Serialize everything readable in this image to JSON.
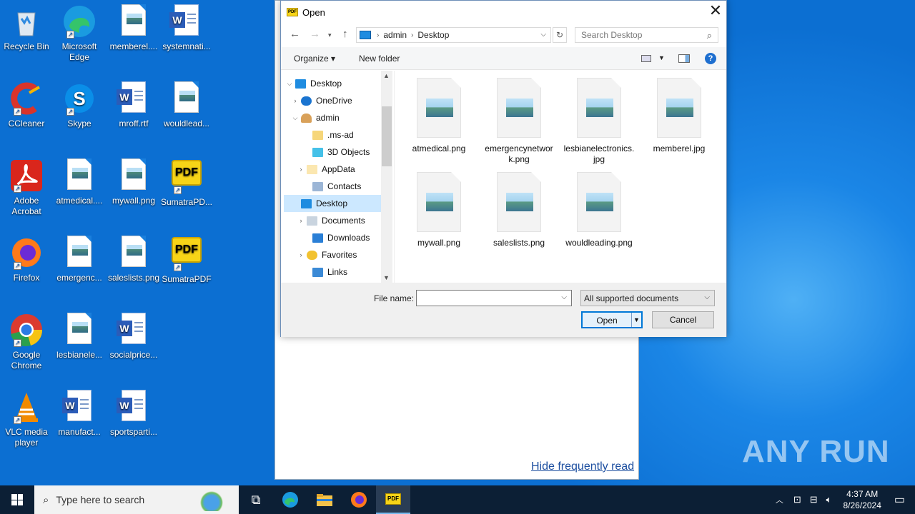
{
  "desktop": {
    "icons": [
      {
        "label": "Recycle Bin"
      },
      {
        "label": "Microsoft Edge"
      },
      {
        "label": "memberel...."
      },
      {
        "label": "systemnati..."
      },
      {
        "label": "CCleaner"
      },
      {
        "label": "Skype"
      },
      {
        "label": "mroff.rtf"
      },
      {
        "label": "wouldlead..."
      },
      {
        "label": "Adobe Acrobat"
      },
      {
        "label": "atmedical...."
      },
      {
        "label": "mywall.png"
      },
      {
        "label": "SumatraPD..."
      },
      {
        "label": "Firefox"
      },
      {
        "label": "emergenc..."
      },
      {
        "label": "saleslists.png"
      },
      {
        "label": "SumatraPDF"
      },
      {
        "label": "Google Chrome"
      },
      {
        "label": "lesbianele..."
      },
      {
        "label": "socialprice..."
      },
      {
        "label": "VLC media player"
      },
      {
        "label": "manufact..."
      },
      {
        "label": "sportsparti..."
      }
    ]
  },
  "background_window": {
    "hide_link": "Hide frequently read"
  },
  "watermark": "ANY RUN",
  "dialog": {
    "title": "Open",
    "address": {
      "crumbs": [
        "admin",
        "Desktop"
      ]
    },
    "search_placeholder": "Search Desktop",
    "toolbar": {
      "organize": "Organize ▾",
      "new_folder": "New folder"
    },
    "tree": [
      {
        "label": "Desktop"
      },
      {
        "label": "OneDrive"
      },
      {
        "label": "admin"
      },
      {
        "label": ".ms-ad"
      },
      {
        "label": "3D Objects"
      },
      {
        "label": "AppData"
      },
      {
        "label": "Contacts"
      },
      {
        "label": "Desktop"
      },
      {
        "label": "Documents"
      },
      {
        "label": "Downloads"
      },
      {
        "label": "Favorites"
      },
      {
        "label": "Links"
      }
    ],
    "files": [
      {
        "name": "atmedical.png"
      },
      {
        "name": "emergencynetwork.png"
      },
      {
        "name": "lesbianelectronics.jpg"
      },
      {
        "name": "memberel.jpg"
      },
      {
        "name": "mywall.png"
      },
      {
        "name": "saleslists.png"
      },
      {
        "name": "wouldleading.png"
      }
    ],
    "file_name_label": "File name:",
    "file_name_value": "",
    "file_type": "All supported documents",
    "open_label": "Open",
    "cancel_label": "Cancel"
  },
  "taskbar": {
    "search_placeholder": "Type here to search",
    "time": "4:37 AM",
    "date": "8/26/2024"
  }
}
